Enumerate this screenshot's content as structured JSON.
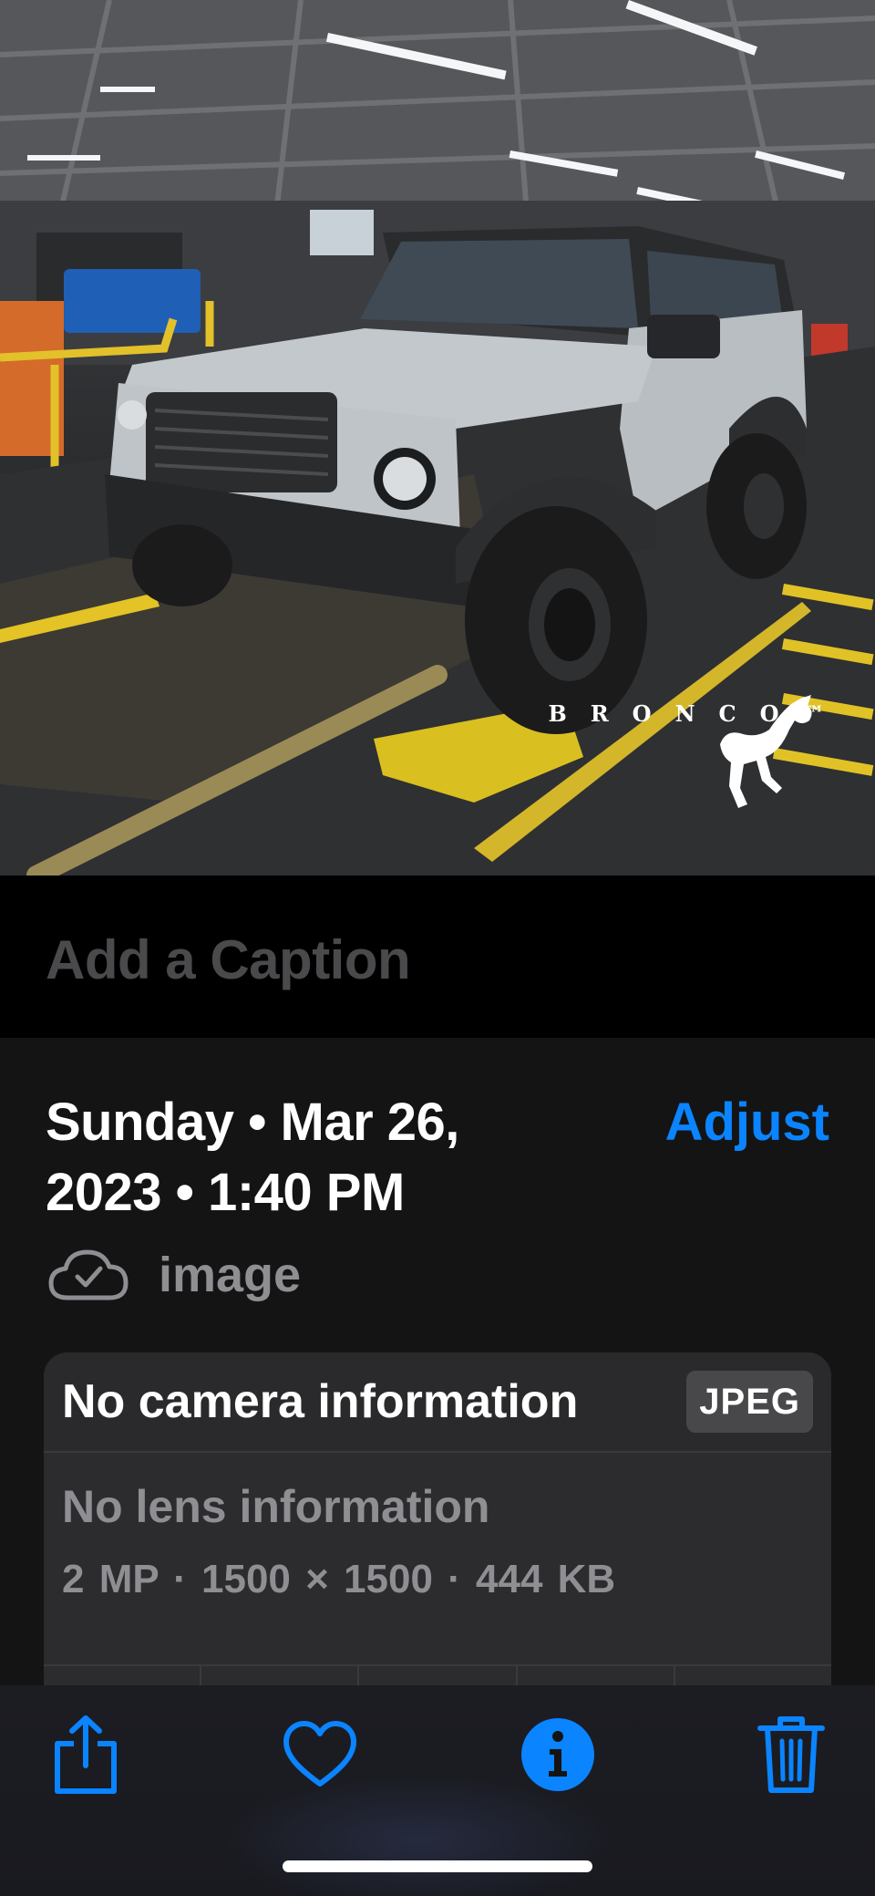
{
  "caption": {
    "placeholder": "Add a Caption"
  },
  "info": {
    "date_line1": "Sunday • Mar 26,",
    "date_line2": "2023 • 1:40 PM",
    "adjust_label": "Adjust",
    "filename": "image",
    "camera": "No camera information",
    "format_badge": "JPEG",
    "lens": "No lens information",
    "specs": "2 MP  ·  1500 × 1500  ·  444 KB"
  },
  "photo": {
    "watermark_text": "BRONCO™"
  },
  "toolbar": {
    "icons": [
      "share-icon",
      "heart-icon",
      "info-icon",
      "trash-icon"
    ]
  },
  "colors": {
    "accent": "#0a84ff",
    "panel_bg": "#141414",
    "card_bg": "#2c2c2e",
    "secondary_text": "#8e8e93"
  }
}
